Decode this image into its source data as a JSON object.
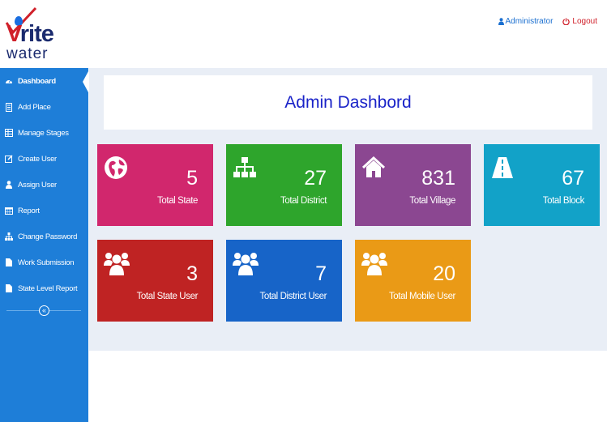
{
  "header": {
    "logo_main": "rite",
    "logo_v": "V",
    "logo_sub": "water",
    "user_label": "Administrator",
    "logout_label": "Logout"
  },
  "sidebar": {
    "items": [
      {
        "label": "Dashboard",
        "icon": "dashboard-icon",
        "active": true
      },
      {
        "label": "Add Place",
        "icon": "document-icon"
      },
      {
        "label": "Manage Stages",
        "icon": "table-icon"
      },
      {
        "label": "Create User",
        "icon": "edit-icon"
      },
      {
        "label": "Assign User",
        "icon": "user-icon"
      },
      {
        "label": "Report",
        "icon": "calendar-icon"
      },
      {
        "label": "Change Password",
        "icon": "sitemap-icon"
      },
      {
        "label": "Work Submission",
        "icon": "file-icon"
      },
      {
        "label": "State Level Report",
        "icon": "file-icon"
      }
    ],
    "collapse_glyph": "«"
  },
  "main": {
    "title": "Admin Dashbord",
    "tiles": [
      {
        "value": "5",
        "label": "Total State",
        "color": "#d1276d",
        "icon": "globe-icon"
      },
      {
        "value": "27",
        "label": "Total District",
        "color": "#2ea52c",
        "icon": "sitemap-icon"
      },
      {
        "value": "831",
        "label": "Total Village",
        "color": "#8b4791",
        "icon": "home-icon"
      },
      {
        "value": "67",
        "label": "Total Block",
        "color": "#12a2c8",
        "icon": "road-icon"
      },
      {
        "value": "3",
        "label": "Total State User",
        "color": "#bf2323",
        "icon": "users-icon"
      },
      {
        "value": "7",
        "label": "Total District User",
        "color": "#1764c8",
        "icon": "users-icon"
      },
      {
        "value": "20",
        "label": "Total Mobile User",
        "color": "#ea9a16",
        "icon": "users-icon"
      }
    ]
  }
}
